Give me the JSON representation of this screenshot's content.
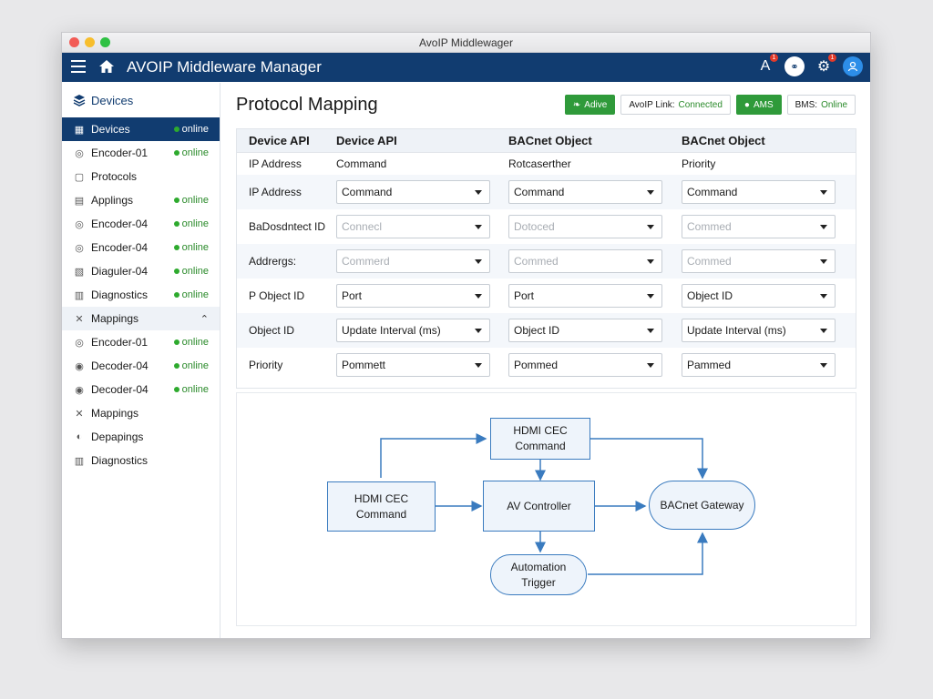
{
  "window_title": "AvoIP Middlewager",
  "app_title": "AVOIP Middleware Manager",
  "header_icons": [
    {
      "name": "alerts-icon",
      "glyph": "A",
      "badge": "1"
    },
    {
      "name": "network-icon",
      "glyph": "⚭",
      "badge": ""
    },
    {
      "name": "gear-icon",
      "glyph": "⚙",
      "badge": "1"
    },
    {
      "name": "user-icon",
      "glyph": "👤",
      "badge": ""
    }
  ],
  "sidebar": {
    "header": "Devices",
    "items": [
      {
        "label": "Devices",
        "status": "online",
        "icon": "devices-icon",
        "active": true
      },
      {
        "label": "Encoder-01",
        "status": "online",
        "icon": "encoder-icon"
      },
      {
        "label": "Protocols",
        "status": "",
        "icon": "protocols-icon"
      },
      {
        "label": "Applings",
        "status": "online",
        "icon": "applings-icon"
      },
      {
        "label": "Encoder-04",
        "status": "online",
        "icon": "encoder-icon"
      },
      {
        "label": "Encoder-04",
        "status": "online",
        "icon": "encoder-icon"
      },
      {
        "label": "Diaguler-04",
        "status": "online",
        "icon": "diaguler-icon"
      },
      {
        "label": "Diagnostics",
        "status": "online",
        "icon": "diagnostics-icon"
      },
      {
        "label": "Mappings",
        "status": "",
        "icon": "mappings-icon",
        "section": true
      },
      {
        "label": "Encoder-01",
        "status": "online",
        "icon": "encoder-icon"
      },
      {
        "label": "Decoder-04",
        "status": "online",
        "icon": "decoder-icon"
      },
      {
        "label": "Decoder-04",
        "status": "online",
        "icon": "decoder-icon"
      },
      {
        "label": "Mappings",
        "status": "",
        "icon": "mappings-icon"
      },
      {
        "label": "Depapings",
        "status": "",
        "icon": "depapings-icon"
      },
      {
        "label": "Diagnostics",
        "status": "",
        "icon": "diagnostics-icon"
      }
    ]
  },
  "page_title": "Protocol Mapping",
  "status_bar": {
    "active_label": "Adive",
    "link_label": "AvoIP Link:",
    "link_value": "Connected",
    "ams_label": "AMS",
    "bms_label": "BMS:",
    "bms_value": "Online"
  },
  "grid": {
    "headers": [
      "Device API",
      "Device API",
      "BACnet Object",
      "BACnet Object"
    ],
    "subheaders": [
      "IP Address",
      "Command",
      "Rotcaserther",
      "Priority"
    ],
    "rows": [
      {
        "label": "IP Address",
        "cells": [
          {
            "v": "Command"
          },
          {
            "v": "Command"
          },
          {
            "v": "Command"
          }
        ]
      },
      {
        "label": "BaDosdntect ID",
        "cells": [
          {
            "v": "Connecl",
            "dis": true
          },
          {
            "v": "Dotoced",
            "dis": true
          },
          {
            "v": "Commed",
            "dis": true
          }
        ]
      },
      {
        "label": "Addrergs:",
        "cells": [
          {
            "v": "Commerd",
            "dis": true
          },
          {
            "v": "Commed",
            "dis": true
          },
          {
            "v": "Commed",
            "dis": true
          }
        ]
      },
      {
        "label": "P Object ID",
        "cells": [
          {
            "v": "Port"
          },
          {
            "v": "Port"
          },
          {
            "v": "Object ID"
          }
        ]
      },
      {
        "label": "Object ID",
        "cells": [
          {
            "v": "Update Interval (ms)"
          },
          {
            "v": "Object ID"
          },
          {
            "v": "Update Interval (ms)"
          }
        ]
      },
      {
        "label": "Priority",
        "cells": [
          {
            "v": "Pommett"
          },
          {
            "v": "Pommed"
          },
          {
            "v": "Pammed"
          }
        ]
      }
    ]
  },
  "diagram": {
    "hdmi_top": "HDMI CEC Command",
    "hdmi_left": "HDMI CEC Command",
    "av_controller": "AV Controller",
    "bacnet_gateway": "BACnet Gateway",
    "automation_trigger": "Automation Trigger",
    "line_color": "#3a7bbf"
  }
}
